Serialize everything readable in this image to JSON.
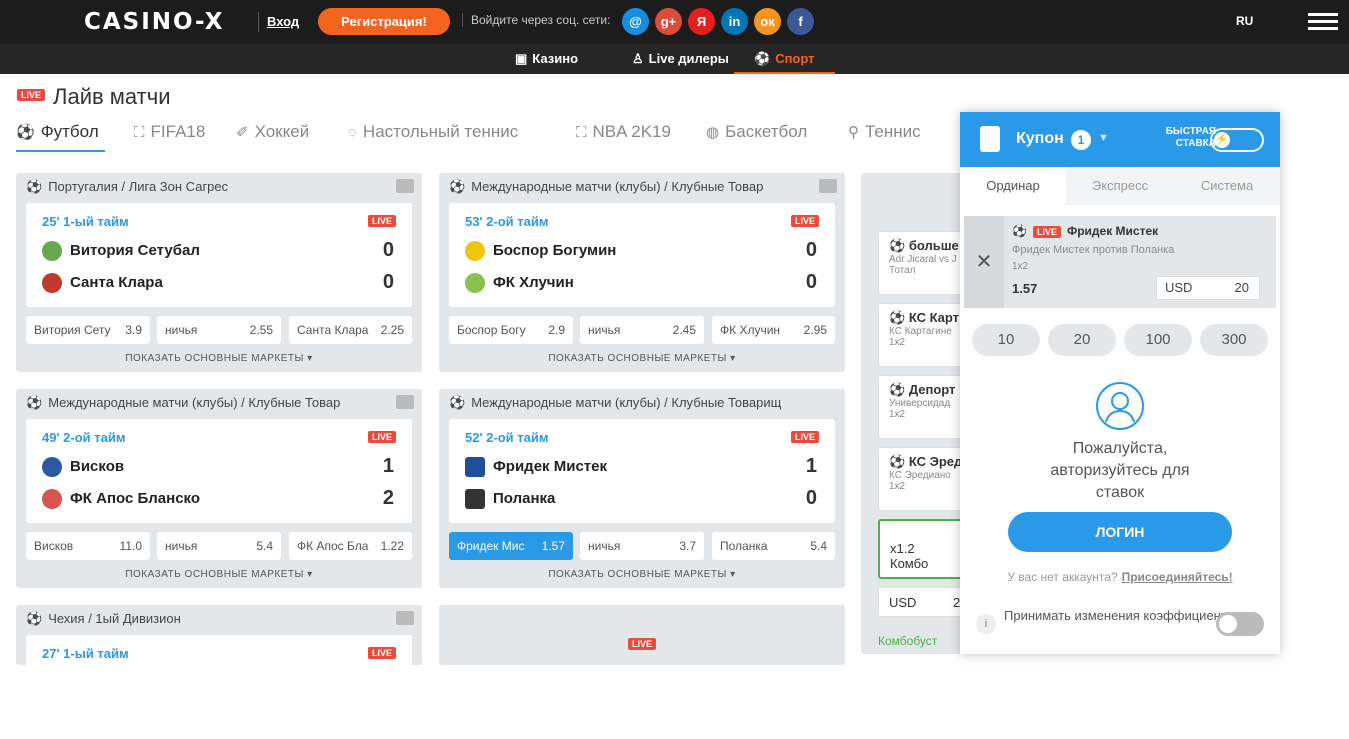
{
  "header": {
    "logo": "CASINO-X",
    "login": "Вход",
    "register": "Регистрация!",
    "social_text": "Войдите через соц. сети:",
    "social": [
      {
        "label": "@",
        "color": "#168de2",
        "icon": "mail-icon"
      },
      {
        "label": "g+",
        "color": "#dd4b39",
        "icon": "google-plus-icon"
      },
      {
        "label": "Я",
        "color": "#e61e1e",
        "icon": "yandex-icon"
      },
      {
        "label": "in",
        "color": "#0077b5",
        "icon": "linkedin-icon"
      },
      {
        "label": "ок",
        "color": "#f7931e",
        "icon": "odnoklassniki-icon"
      },
      {
        "label": "f",
        "color": "#3b5998",
        "icon": "facebook-icon"
      }
    ],
    "lang": "RU"
  },
  "nav": {
    "casino": "Казино",
    "live": "Live дилеры",
    "sport": "Спорт"
  },
  "page": {
    "live": "LIVE",
    "title": "Лайв матчи"
  },
  "tabs": [
    "Футбол",
    "FIFA18",
    "Хоккей",
    "Настольный теннис",
    "NBA 2K19",
    "Баскетбол",
    "Теннис"
  ],
  "matches": [
    {
      "league": "Португалия / Лига Зон Сагрес",
      "time": "25' 1-ый тайм",
      "live": "LIVE",
      "team1": "Витория Сетубал",
      "score1": "0",
      "team2": "Санта Клара",
      "score2": "0",
      "o1": "Витория Сету",
      "v1": "3.9",
      "ox": "ничья",
      "vx": "2.55",
      "o2": "Санта Клара",
      "v2": "2.25",
      "markets": "ПОКАЗАТЬ ОСНОВНЫЕ МАРКЕТЫ ▾"
    },
    {
      "league": "Международные матчи (клубы) / Клубные Товар",
      "time": "53' 2-ой тайм",
      "live": "LIVE",
      "team1": "Боспор Богумин",
      "score1": "0",
      "team2": "ФК Хлучин",
      "score2": "0",
      "o1": "Боспор Богу",
      "v1": "2.9",
      "ox": "ничья",
      "vx": "2.45",
      "o2": "ФК Хлучин",
      "v2": "2.95",
      "markets": "ПОКАЗАТЬ ОСНОВНЫЕ МАРКЕТЫ ▾"
    },
    {
      "league": "Международные матчи (клубы) / Клубные Товар",
      "time": "49' 2-ой тайм",
      "live": "LIVE",
      "team1": "Висков",
      "score1": "1",
      "team2": "ФК Апос Бланско",
      "score2": "2",
      "o1": "Висков",
      "v1": "11.0",
      "ox": "ничья",
      "vx": "5.4",
      "o2": "ФК Апос Бла",
      "v2": "1.22",
      "markets": "ПОКАЗАТЬ ОСНОВНЫЕ МАРКЕТЫ ▾"
    },
    {
      "league": "Международные матчи (клубы) / Клубные Товарищ",
      "time": "52' 2-ой тайм",
      "live": "LIVE",
      "team1": "Фридек Мистек",
      "score1": "1",
      "team2": "Поланка",
      "score2": "0",
      "o1": "Фридек Мис",
      "v1": "1.57",
      "ox": "ничья",
      "vx": "3.7",
      "o2": "Поланка",
      "v2": "5.4",
      "markets": "ПОКАЗАТЬ ОСНОВНЫЕ МАРКЕТЫ ▾"
    },
    {
      "league": "Чехия / 1ый Дивизион",
      "time": "27' 1-ый тайм",
      "live": "LIVE"
    }
  ],
  "side": [
    {
      "t": "больше",
      "s1": "Adr Jicaral vs J",
      "s2": "Тотал"
    },
    {
      "t": "КС Карт",
      "s1": "КС Картагине",
      "s2": "1x2"
    },
    {
      "t": "Депорт",
      "s1": "Универсидад",
      "s2": "1x2"
    },
    {
      "t": "КС Эред",
      "s1": "КС Эредиано",
      "s2": "1x2"
    }
  ],
  "side_combo": "x1.2 Комбо",
  "side_currency": "USD",
  "side_currency_value": "2",
  "side_combo_boost": "Комбобуст",
  "coupon": {
    "title": "Купон",
    "count": "1",
    "fast": "БЫСТРАЯ СТАВКА",
    "tabs": [
      "Ординар",
      "Экспресс",
      "Система"
    ],
    "bet": {
      "match": "Фридек Мистек",
      "live": "LIVE",
      "vs": "Фридек Мистек против Поланка",
      "market": "1x2",
      "odds": "1.57",
      "currency": "USD",
      "stake": "20"
    },
    "quick": [
      "10",
      "20",
      "100",
      "300"
    ],
    "msg": "Пожалуйста, авторизуйтесь для ставок",
    "login": "ЛОГИН",
    "noacc": "У вас нет аккаунта?",
    "join": "Присоединяйтесь!",
    "accept": "Принимать изменения коэффициентов"
  }
}
